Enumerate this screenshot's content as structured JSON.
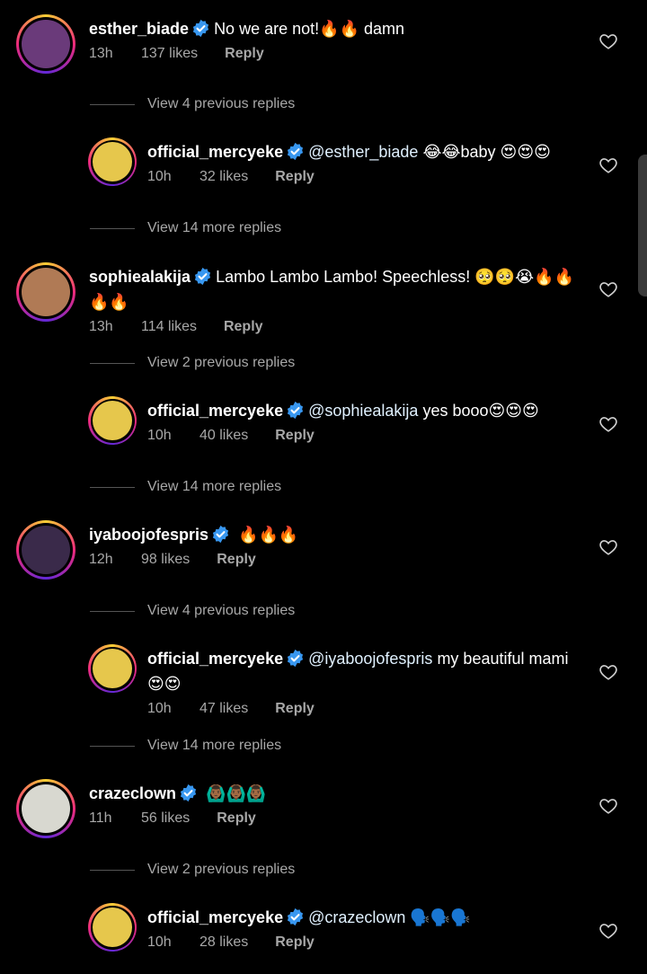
{
  "comments": [
    {
      "user": "esther_biade",
      "text": "No we are not!🔥🔥 damn",
      "time": "13h",
      "likes": "137 likes",
      "reply": "Reply",
      "avatar_color": "#6a3a7a"
    },
    {
      "user": "official_mercyeke",
      "mention": "@esther_biade",
      "text": " 😂😂baby 😍😍😍",
      "time": "10h",
      "likes": "32 likes",
      "reply": "Reply",
      "avatar_color": "#e6c74c"
    },
    {
      "user": "sophiealakija",
      "text": "Lambo Lambo Lambo! Speechless! 🥺🥺😭🔥🔥🔥🔥",
      "time": "13h",
      "likes": "114 likes",
      "reply": "Reply",
      "avatar_color": "#b07a55"
    },
    {
      "user": "official_mercyeke",
      "mention": "@sophiealakija",
      "text": " yes booo😍😍😍",
      "time": "10h",
      "likes": "40 likes",
      "reply": "Reply",
      "avatar_color": "#e6c74c"
    },
    {
      "user": "iyaboojofespris",
      "text": " 🔥🔥🔥",
      "time": "12h",
      "likes": "98 likes",
      "reply": "Reply",
      "avatar_color": "#3a2a4a"
    },
    {
      "user": "official_mercyeke",
      "mention": "@iyaboojofespris",
      "text": " my beautiful mami 😍😍",
      "time": "10h",
      "likes": "47 likes",
      "reply": "Reply",
      "avatar_color": "#e6c74c"
    },
    {
      "user": "crazeclown",
      "text": " 🙆🏾‍♂️🙆🏾‍♂️🙆🏾‍♂️",
      "time": "11h",
      "likes": "56 likes",
      "reply": "Reply",
      "avatar_color": "#d8d8d0"
    },
    {
      "user": "official_mercyeke",
      "mention": "@crazeclown",
      "text": " 🗣️🗣️🗣️",
      "time": "10h",
      "likes": "28 likes",
      "reply": "Reply",
      "avatar_color": "#e6c74c"
    }
  ],
  "view_rows": [
    "View 4 previous replies",
    "View 14 more replies",
    "View 2 previous replies",
    "View 14 more replies",
    "View 4 previous replies",
    "View 14 more replies",
    "View 2 previous replies"
  ],
  "colors": {
    "background": "#000000",
    "secondary_text": "#a8a8a8",
    "verified": "#3897f0"
  },
  "icons": {
    "verified": "verified-badge-icon",
    "like": "heart-outline-icon"
  }
}
